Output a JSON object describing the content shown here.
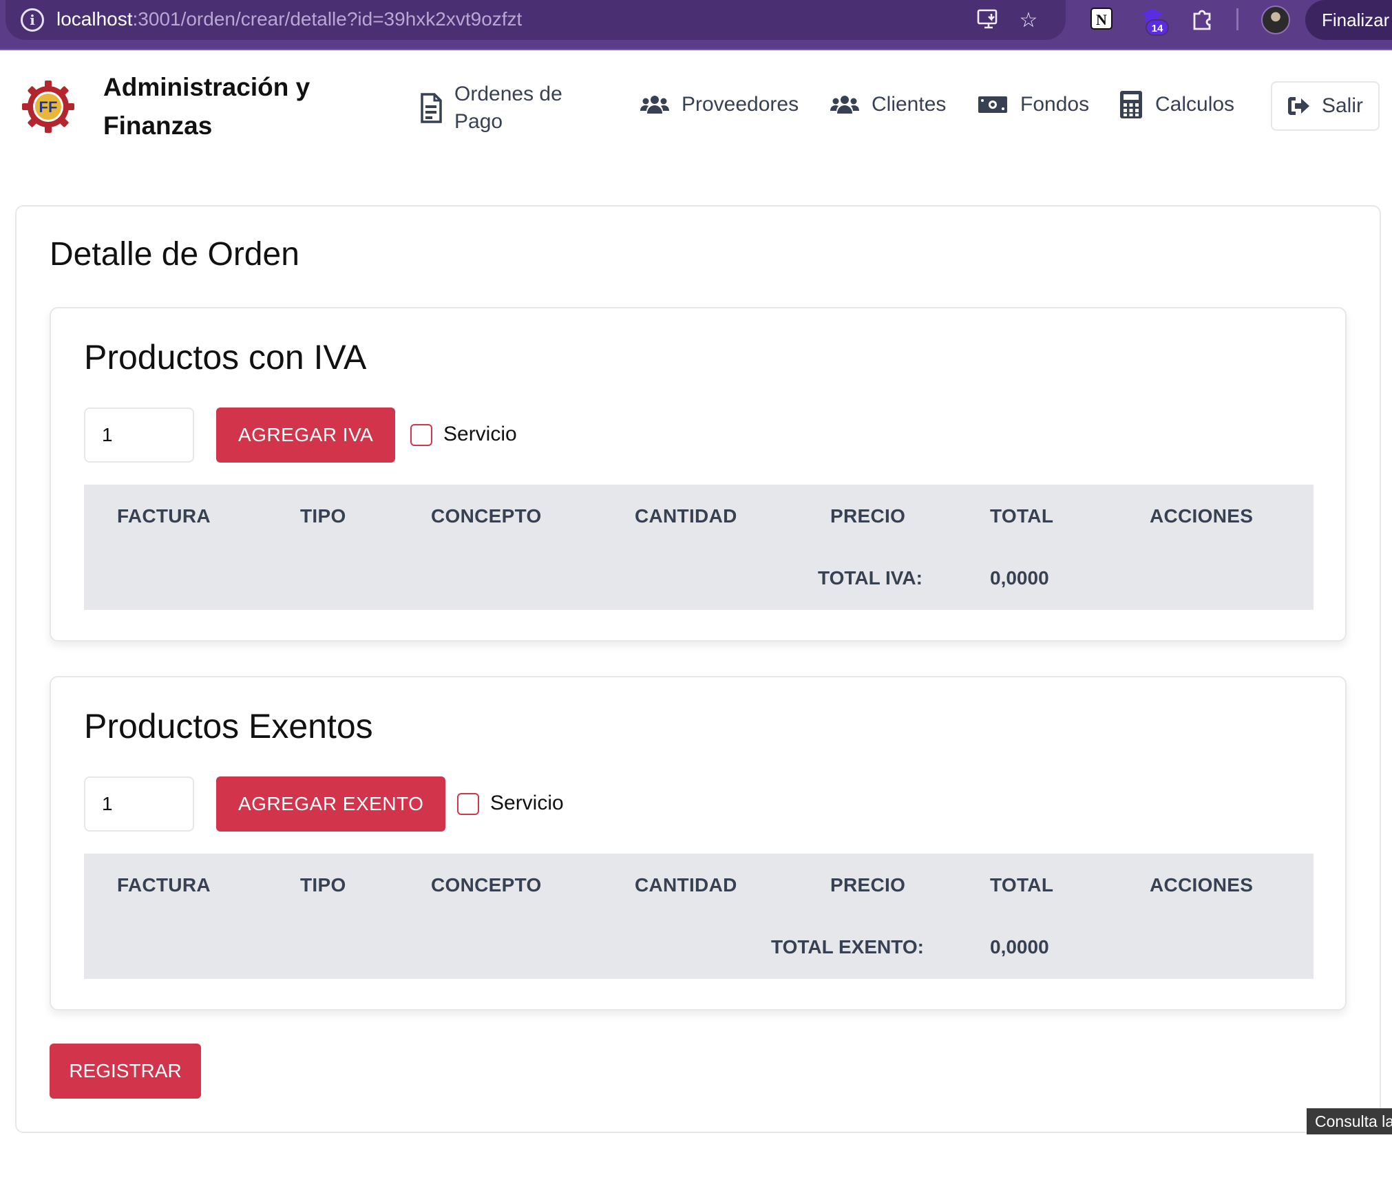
{
  "browser": {
    "url_host": "localhost",
    "url_path": ":3001/orden/crear/detalle?id=39hxk2xvt9ozfzt",
    "extension_badge": "14",
    "finalize_label": "Finalizar"
  },
  "nav": {
    "brand": "Administración y Finanzas",
    "items": [
      {
        "label": "Ordenes de Pago",
        "icon": "file-invoice-icon"
      },
      {
        "label": "Proveedores",
        "icon": "users-icon"
      },
      {
        "label": "Clientes",
        "icon": "users-icon"
      },
      {
        "label": "Fondos",
        "icon": "money-bill-icon"
      },
      {
        "label": "Calculos",
        "icon": "calculator-icon"
      }
    ],
    "logout_label": "Salir"
  },
  "page": {
    "title": "Detalle de Orden"
  },
  "iva_section": {
    "title": "Productos con IVA",
    "quantity_value": "1",
    "add_button": "AGREGAR IVA",
    "service_label": "Servicio",
    "service_checked": false,
    "columns": [
      "FACTURA",
      "TIPO",
      "CONCEPTO",
      "CANTIDAD",
      "PRECIO",
      "TOTAL",
      "ACCIONES"
    ],
    "rows": [],
    "total_label": "TOTAL IVA:",
    "total_value": "0,0000"
  },
  "exento_section": {
    "title": "Productos Exentos",
    "quantity_value": "1",
    "add_button": "AGREGAR EXENTO",
    "service_label": "Servicio",
    "service_checked": false,
    "columns": [
      "FACTURA",
      "TIPO",
      "CONCEPTO",
      "CANTIDAD",
      "PRECIO",
      "TOTAL",
      "ACCIONES"
    ],
    "rows": [],
    "total_label": "TOTAL EXENTO:",
    "total_value": "0,0000"
  },
  "actions": {
    "register_button": "REGISTRAR"
  },
  "tooltip": {
    "text": "Consulta la"
  },
  "colors": {
    "accent_red": "#d1344b",
    "browser_purple": "#5b3c88",
    "table_header_bg": "#e5e7eb",
    "text_gray": "#374151"
  }
}
